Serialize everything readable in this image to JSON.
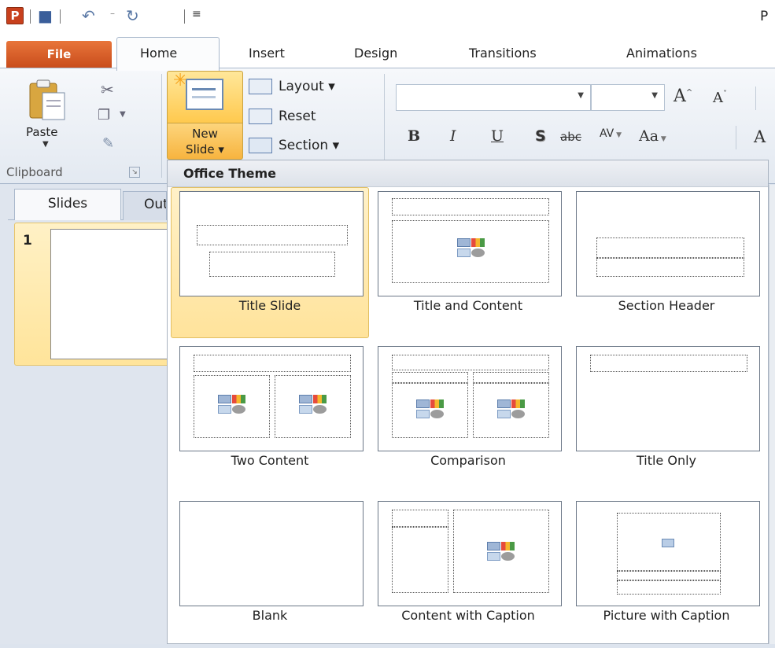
{
  "window": {
    "title_partial": "P"
  },
  "ribbon_tabs": [
    "File",
    "Home",
    "Insert",
    "Design",
    "Transitions",
    "Animations"
  ],
  "clipboard": {
    "paste_label": "Paste",
    "group_label": "Clipboard"
  },
  "slides_group": {
    "new_slide_line1": "New",
    "new_slide_line2": "Slide ▾",
    "layout_label": "Layout ▾",
    "reset_label": "Reset",
    "section_label": "Section ▾"
  },
  "font": {
    "grow": "A",
    "shrink": "A",
    "bold": "B",
    "italic": "I",
    "underline": "U",
    "shadow": "S",
    "strikethrough": "abc",
    "spacing": "AV",
    "change_case": "Aa",
    "font_color": "A"
  },
  "pane": {
    "tab_slides": "Slides",
    "tab_outline": "Outline",
    "slide_number": "1"
  },
  "gallery": {
    "header": "Office Theme",
    "layouts": [
      {
        "name": "Title Slide"
      },
      {
        "name": "Title and Content"
      },
      {
        "name": "Section Header"
      },
      {
        "name": "Two Content"
      },
      {
        "name": "Comparison"
      },
      {
        "name": "Title Only"
      },
      {
        "name": "Blank"
      },
      {
        "name": "Content with Caption"
      },
      {
        "name": "Picture with Caption"
      }
    ]
  },
  "colors": {
    "file_tab": "#d0541f",
    "selection": "#ffe39b",
    "accent": "#5d7eac"
  }
}
